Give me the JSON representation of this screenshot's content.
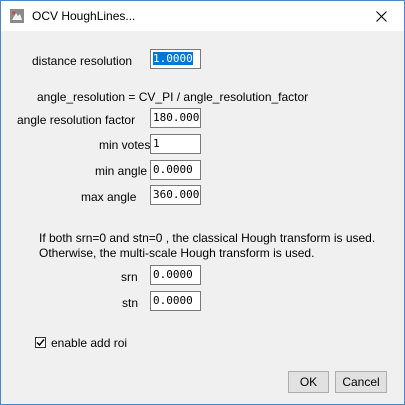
{
  "window": {
    "title": "OCV HoughLines...",
    "icons": {
      "app": "app-icon",
      "close": "close-icon"
    }
  },
  "form": {
    "distance_resolution": {
      "label": "distance resolution",
      "value": "1.0000"
    },
    "angle_note": "angle_resolution = CV_PI / angle_resolution_factor",
    "angle_resolution_factor": {
      "label": "angle resolution factor",
      "value": "180.0000"
    },
    "min_votes": {
      "label": "min votes",
      "value": "1"
    },
    "min_angle": {
      "label": "min angle",
      "value": "0.0000"
    },
    "max_angle": {
      "label": "max angle",
      "value": "360.0000"
    },
    "info_line1": "If both srn=0 and stn=0 , the classical Hough transform is used.",
    "info_line2": "Otherwise, the multi-scale Hough transform is used.",
    "srn": {
      "label": "srn",
      "value": "0.0000"
    },
    "stn": {
      "label": "stn",
      "value": "0.0000"
    },
    "enable_add_roi": {
      "label": "enable add roi",
      "checked": true
    }
  },
  "buttons": {
    "ok": "OK",
    "cancel": "Cancel"
  }
}
